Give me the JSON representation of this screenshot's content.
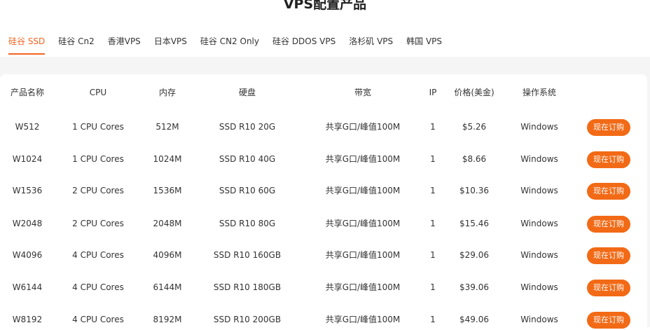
{
  "page": {
    "title": "VPS配置产品"
  },
  "tabs": [
    {
      "label": "硅谷 SSD",
      "active": true
    },
    {
      "label": "硅谷 Cn2",
      "active": false
    },
    {
      "label": "香港VPS",
      "active": false
    },
    {
      "label": "日本VPS",
      "active": false
    },
    {
      "label": "硅谷 CN2 Only",
      "active": false
    },
    {
      "label": "硅谷 DDOS VPS",
      "active": false
    },
    {
      "label": "洛杉矶 VPS",
      "active": false
    },
    {
      "label": "韩国 VPS",
      "active": false
    }
  ],
  "table": {
    "headers": {
      "name": "产品名称",
      "cpu": "CPU",
      "ram": "内存",
      "disk": "硬盘",
      "bandwidth": "带宽",
      "ip": "IP",
      "price": "价格(美金)",
      "os": "操作系统"
    },
    "rows": [
      {
        "name": "W512",
        "cpu": "1 CPU Cores",
        "ram": "512M",
        "disk": "SSD R10 20G",
        "bandwidth": "共享G口/峰值100M",
        "ip": "1",
        "price": "$5.26",
        "os": "Windows",
        "button": "现在订购"
      },
      {
        "name": "W1024",
        "cpu": "1 CPU Cores",
        "ram": "1024M",
        "disk": "SSD R10 40G",
        "bandwidth": "共享G口/峰值100M",
        "ip": "1",
        "price": "$8.66",
        "os": "Windows",
        "button": "现在订购"
      },
      {
        "name": "W1536",
        "cpu": "2 CPU Cores",
        "ram": "1536M",
        "disk": "SSD R10 60G",
        "bandwidth": "共享G口/峰值100M",
        "ip": "1",
        "price": "$10.36",
        "os": "Windows",
        "button": "现在订购"
      },
      {
        "name": "W2048",
        "cpu": "2 CPU Cores",
        "ram": "2048M",
        "disk": "SSD R10 80G",
        "bandwidth": "共享G口/峰值100M",
        "ip": "1",
        "price": "$15.46",
        "os": "Windows",
        "button": "现在订购"
      },
      {
        "name": "W4096",
        "cpu": "4 CPU Cores",
        "ram": "4096M",
        "disk": "SSD R10 160GB",
        "bandwidth": "共享G口/峰值100M",
        "ip": "1",
        "price": "$29.06",
        "os": "Windows",
        "button": "现在订购"
      },
      {
        "name": "W6144",
        "cpu": "4 CPU Cores",
        "ram": "6144M",
        "disk": "SSD R10 180GB",
        "bandwidth": "共享G口/峰值100M",
        "ip": "1",
        "price": "$39.06",
        "os": "Windows",
        "button": "现在订购"
      },
      {
        "name": "W8192",
        "cpu": "4 CPU Cores",
        "ram": "8192M",
        "disk": "SSD R10 200GB",
        "bandwidth": "共享G口/峰值100M",
        "ip": "1",
        "price": "$49.06",
        "os": "Windows",
        "button": "现在订购"
      }
    ]
  },
  "colors": {
    "accent": "#f26522",
    "button_bg": "#f26a16",
    "band_bg": "#f5f5f6"
  }
}
